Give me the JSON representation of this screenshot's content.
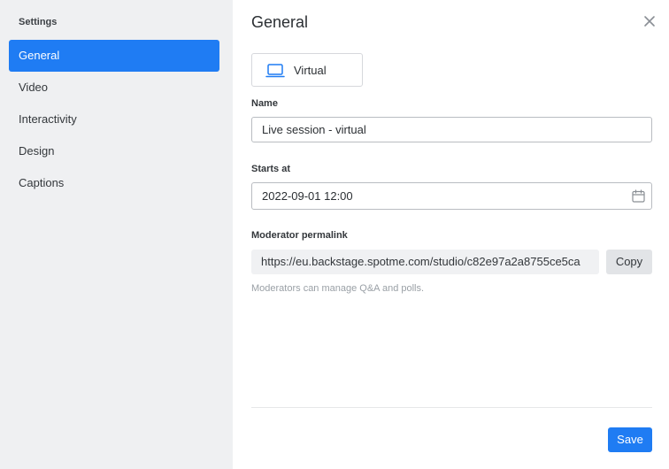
{
  "sidebar": {
    "title": "Settings",
    "items": [
      {
        "label": "General",
        "active": true
      },
      {
        "label": "Video",
        "active": false
      },
      {
        "label": "Interactivity",
        "active": false
      },
      {
        "label": "Design",
        "active": false
      },
      {
        "label": "Captions",
        "active": false
      }
    ]
  },
  "main": {
    "title": "General",
    "close_icon": "close-icon",
    "session_type": {
      "icon": "laptop-icon",
      "label": "Virtual"
    },
    "name": {
      "label": "Name",
      "value": "Live session - virtual"
    },
    "starts_at": {
      "label": "Starts at",
      "value": "2022-09-01 12:00",
      "icon": "calendar-icon"
    },
    "moderator_permalink": {
      "label": "Moderator permalink",
      "value": "https://eu.backstage.spotme.com/studio/c82e97a2a8755ce5ca",
      "copy_label": "Copy",
      "hint": "Moderators can manage Q&A and polls."
    },
    "save_label": "Save"
  },
  "colors": {
    "accent": "#1f7cf3",
    "sidebar_bg": "#eff0f2"
  }
}
